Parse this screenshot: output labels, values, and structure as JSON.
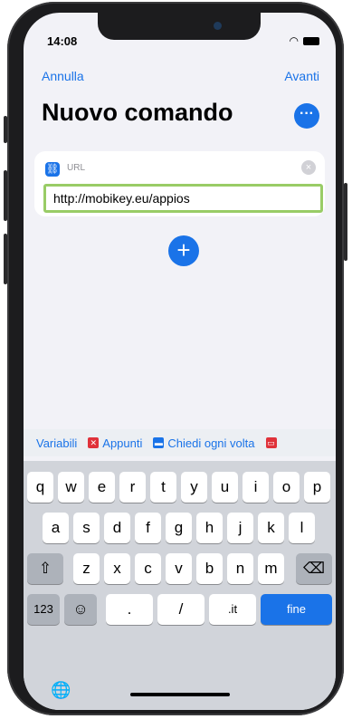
{
  "status": {
    "time": "14:08"
  },
  "nav": {
    "cancel": "Annulla",
    "next": "Avanti"
  },
  "title": "Nuovo comando",
  "card": {
    "label": "URL",
    "url": "http://mobikey.eu/appios"
  },
  "variables": {
    "items": [
      "Variabili",
      "Appunti",
      "Chiedi ogni volta"
    ],
    "colors": {
      "clipboard": "#e0323a",
      "ask": "#1a73e8"
    }
  },
  "keyboard": {
    "row1": [
      "q",
      "w",
      "e",
      "r",
      "t",
      "y",
      "u",
      "i",
      "o",
      "p"
    ],
    "row2": [
      "a",
      "s",
      "d",
      "f",
      "g",
      "h",
      "j",
      "k",
      "l"
    ],
    "row3": [
      "z",
      "x",
      "c",
      "v",
      "b",
      "n",
      "m"
    ],
    "numbers_key": "123",
    "dot_key": ".",
    "slash_key": "/",
    "it_key": ".it",
    "go_key": "fine"
  },
  "accent": "#1a73e8"
}
